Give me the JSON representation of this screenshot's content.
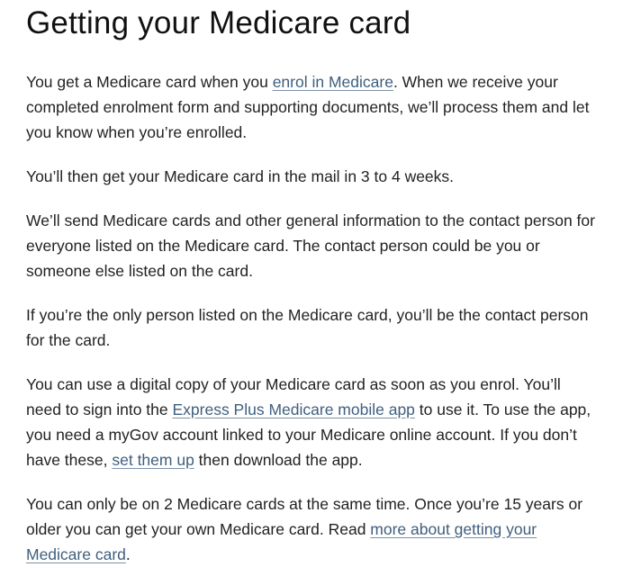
{
  "page": {
    "title": "Getting your Medicare card"
  },
  "paragraphs": [
    {
      "before": "You get a Medicare card when you ",
      "link": "enrol in Medicare",
      "after": ". When we receive your completed enrolment form and supporting documents, we’ll process them and let you know when you’re enrolled."
    },
    {
      "text": "You’ll then get your Medicare card in the mail in 3 to 4 weeks."
    },
    {
      "text": "We’ll send Medicare cards and other general information to the contact person for everyone listed on the Medicare card. The contact person could be you or someone else listed on the card."
    },
    {
      "text": "If you’re the only person listed on the Medicare card, you’ll be the contact person for the card."
    },
    {
      "before": "You can use a digital copy of your Medicare card as soon as you enrol. You’ll need to sign into the ",
      "link": "Express Plus Medicare mobile app",
      "middle": " to use it. To use the app, you need a myGov account linked to your Medicare online account. If you don’t have these, ",
      "link2": "set them up",
      "after": " then download the app."
    },
    {
      "before": "You can only be on 2 Medicare cards at the same time. Once you’re 15 years or older you can get your own Medicare card. Read ",
      "link": "more about getting your Medicare card",
      "after": "."
    }
  ],
  "colors": {
    "link": "#3f5f7e",
    "text": "#222222",
    "heading": "#111111",
    "background": "#ffffff"
  }
}
